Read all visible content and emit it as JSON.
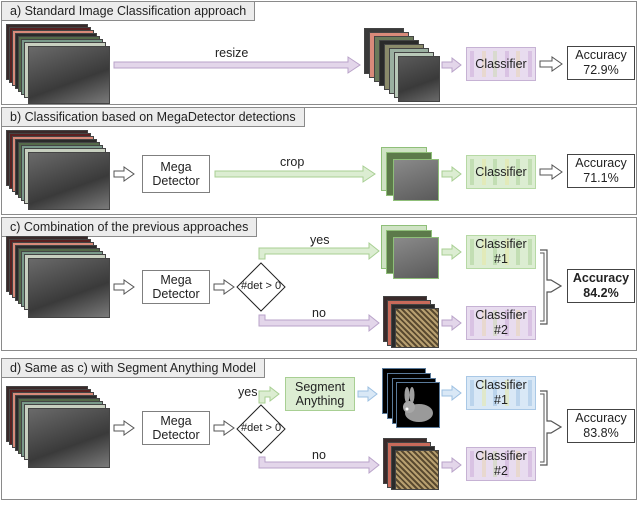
{
  "panels": [
    {
      "title": "a) Standard Image Classification approach",
      "arrow_label": "resize",
      "classifier": "Classifier",
      "accuracy_label": "Accuracy",
      "accuracy_value": "72.9%"
    },
    {
      "title": "b) Classification based on MegaDetector detections",
      "detector_line1": "Mega",
      "detector_line2": "Detector",
      "arrow_label": "crop",
      "classifier": "Classifier",
      "accuracy_label": "Accuracy",
      "accuracy_value": "71.1%"
    },
    {
      "title": "c) Combination of the previous approaches",
      "detector_line1": "Mega",
      "detector_line2": "Detector",
      "decision": "#det > 0",
      "yes_label": "yes",
      "no_label": "no",
      "classifier1_line1": "Classifier",
      "classifier1_line2": "#1",
      "classifier2_line1": "Classifier",
      "classifier2_line2": "#2",
      "accuracy_label": "Accuracy",
      "accuracy_value": "84.2%"
    },
    {
      "title": "d) Same as c) with Segment Anything Model",
      "detector_line1": "Mega",
      "detector_line2": "Detector",
      "decision": "#det > 0",
      "yes_label": "yes",
      "no_label": "no",
      "segment_line1": "Segment",
      "segment_line2": "Anything",
      "classifier1_line1": "Classifier",
      "classifier1_line2": "#1",
      "classifier2_line1": "Classifier",
      "classifier2_line2": "#2",
      "accuracy_label": "Accuracy",
      "accuracy_value": "83.8%"
    }
  ],
  "colors": {
    "purple_fill": "#e3d6ea",
    "purple_stroke": "#b9a3c9",
    "green_fill": "#dcedd2",
    "green_stroke": "#a8cf93",
    "blue_fill": "#d9e8f6",
    "blue_stroke": "#9dc0e2"
  }
}
